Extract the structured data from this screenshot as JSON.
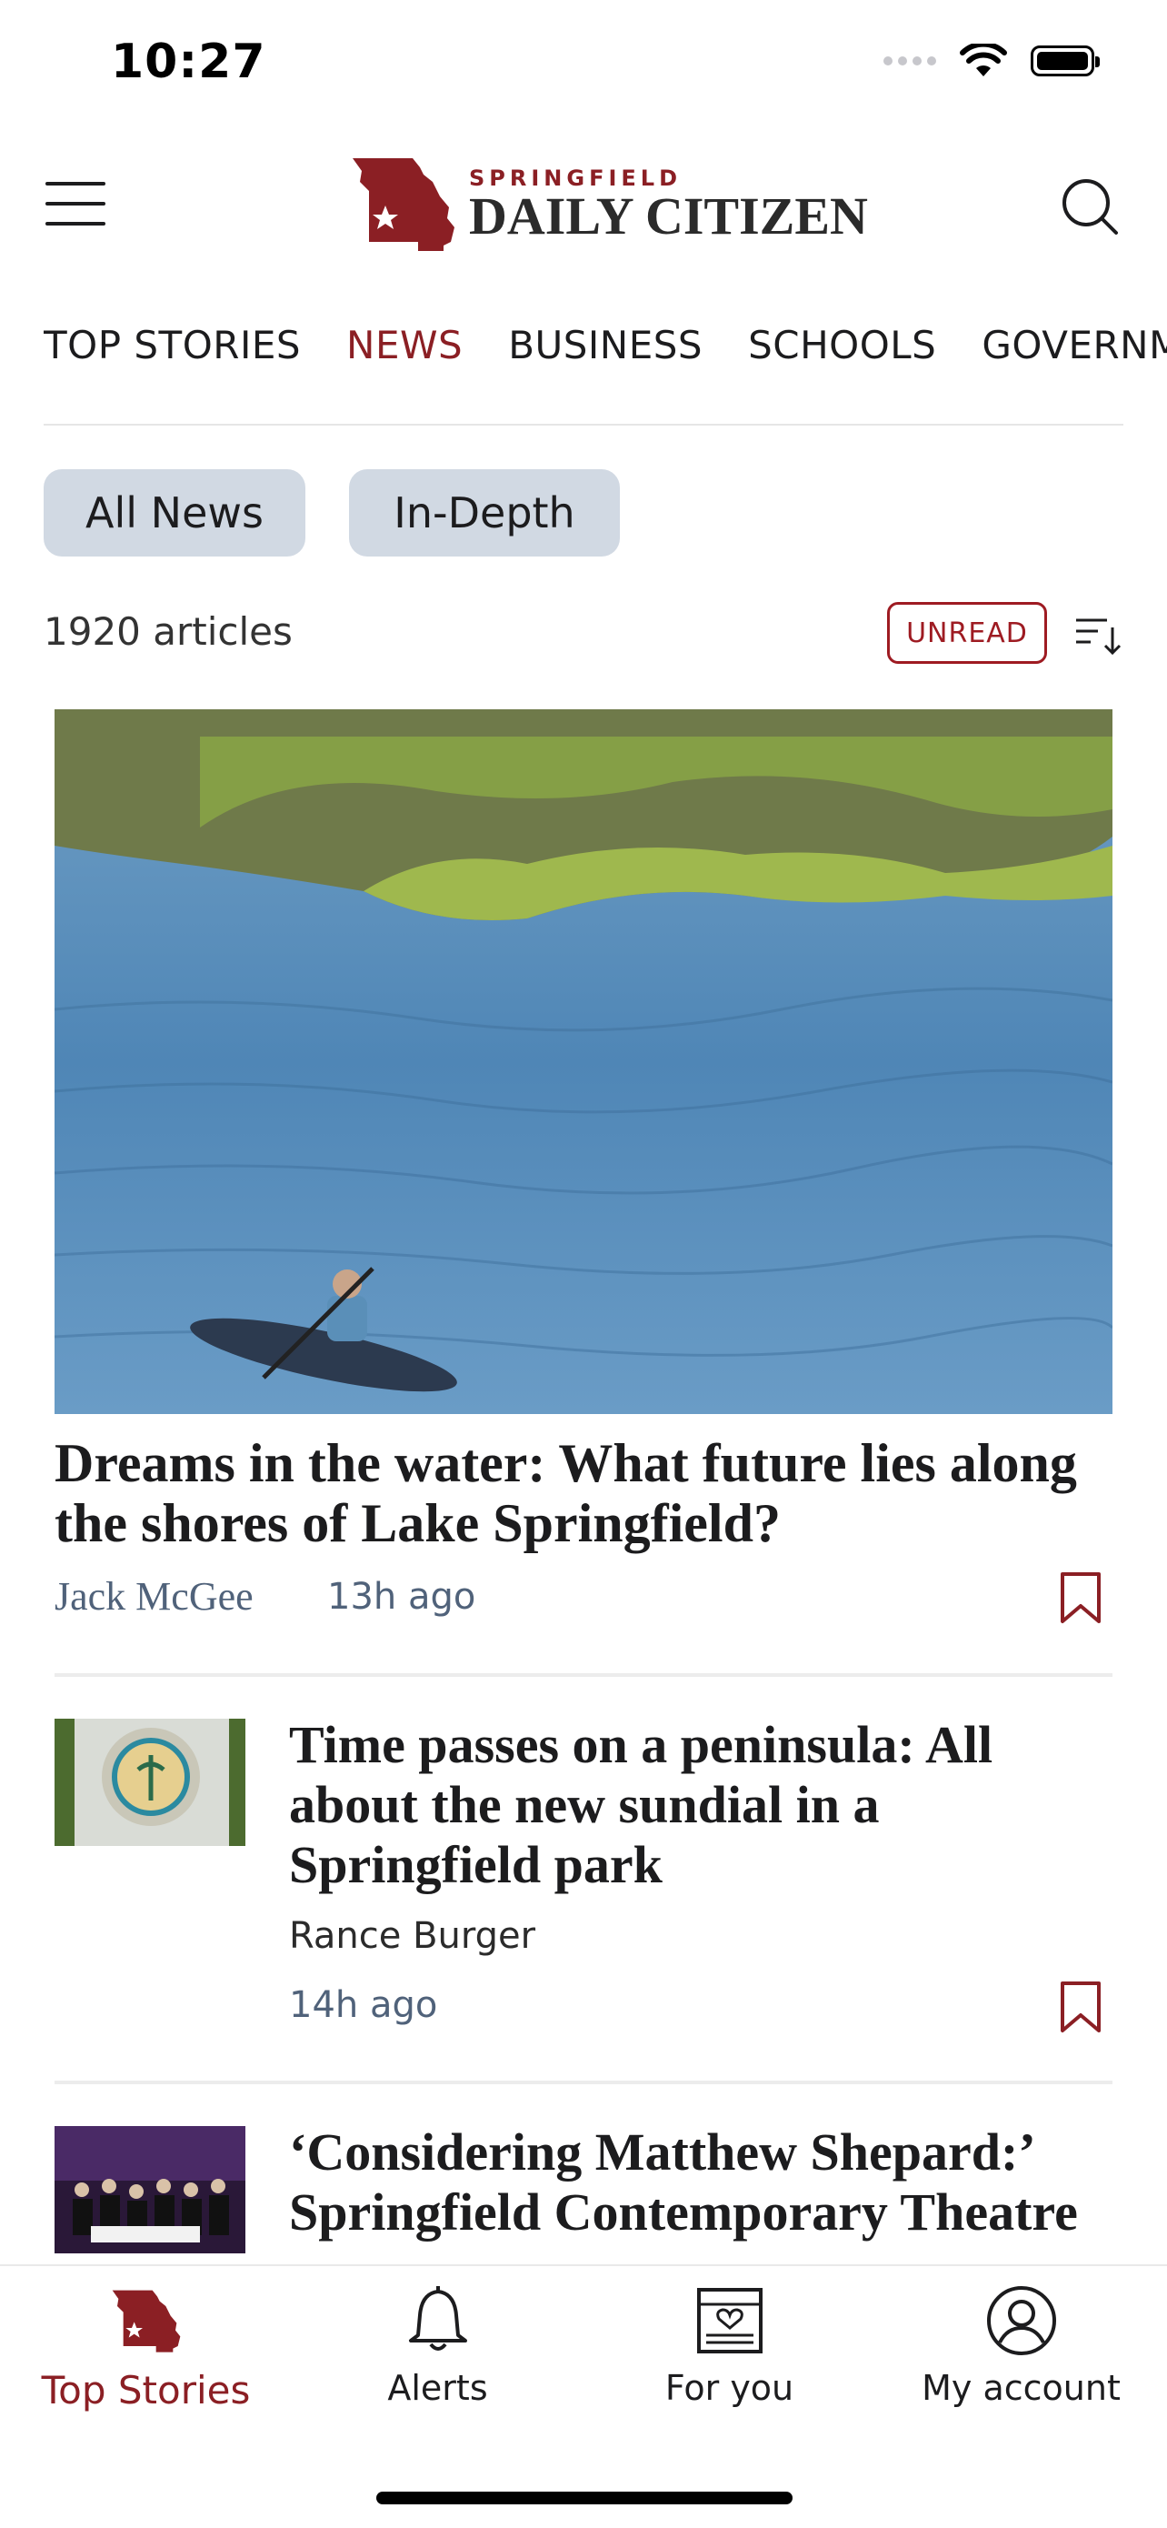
{
  "status_bar": {
    "time": "10:27"
  },
  "header": {
    "logo_small": "SPRINGFIELD",
    "logo_big": "DAILY CITIZEN"
  },
  "tabs": [
    {
      "label": "TOP STORIES",
      "active": false
    },
    {
      "label": "NEWS",
      "active": true
    },
    {
      "label": "BUSINESS",
      "active": false
    },
    {
      "label": "SCHOOLS",
      "active": false
    },
    {
      "label": "GOVERNME",
      "active": false
    }
  ],
  "filters": {
    "all_news": "All News",
    "in_depth": "In-Depth"
  },
  "list_controls": {
    "count": "1920 articles",
    "unread_label": "UNREAD"
  },
  "hero": {
    "title": "Dreams in the water: What future lies along the shores of Lake Springfield?",
    "author": "Jack McGee",
    "time": "13h ago"
  },
  "articles": [
    {
      "title": "Time passes on a peninsula: All about the new sundial in a Springfield park",
      "author": "Rance Burger",
      "time": "14h ago"
    },
    {
      "title": "‘Considering Matthew Shepard:’ Springfield Contemporary Theatre"
    }
  ],
  "bottom_nav": {
    "top_stories": "Top Stories",
    "alerts": "Alerts",
    "for_you": "For you",
    "my_account": "My account"
  },
  "colors": {
    "accent": "#8b1f24",
    "pill_bg": "#d1d9e3",
    "meta": "#50627a"
  }
}
